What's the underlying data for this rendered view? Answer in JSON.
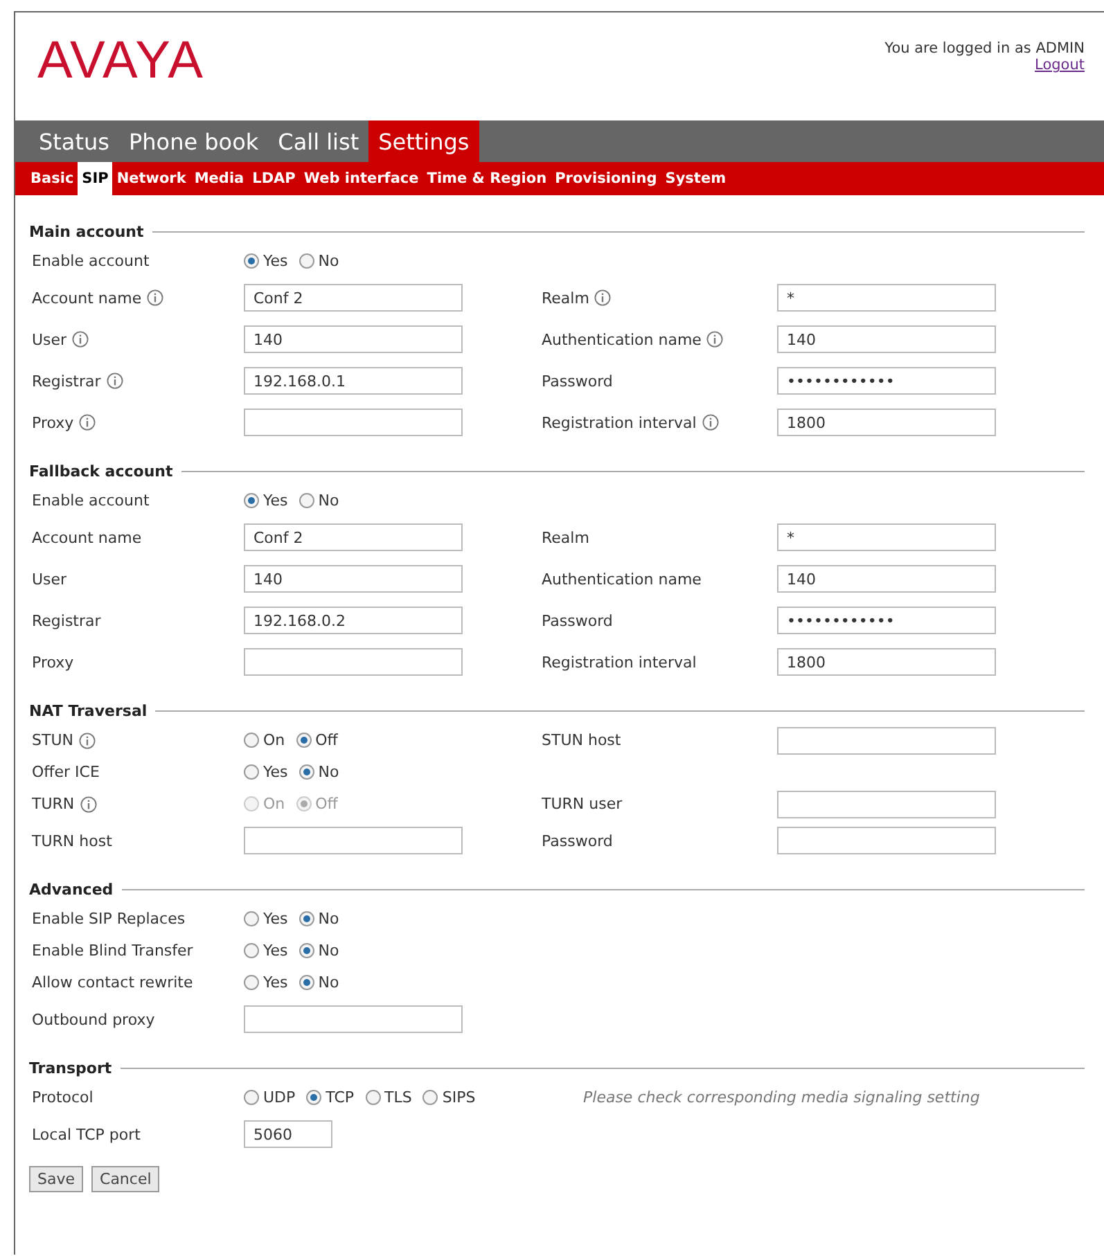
{
  "header": {
    "logo": "AVAYA",
    "login_text": "You are logged in as ADMIN",
    "logout_link": "Logout"
  },
  "main_tabs": [
    {
      "label": "Status",
      "selected": false
    },
    {
      "label": "Phone book",
      "selected": false
    },
    {
      "label": "Call list",
      "selected": false
    },
    {
      "label": "Settings",
      "selected": true
    }
  ],
  "sub_tabs": [
    {
      "label": "Basic",
      "selected": false
    },
    {
      "label": "SIP",
      "selected": true
    },
    {
      "label": "Network",
      "selected": false
    },
    {
      "label": "Media",
      "selected": false
    },
    {
      "label": "LDAP",
      "selected": false
    },
    {
      "label": "Web interface",
      "selected": false
    },
    {
      "label": "Time & Region",
      "selected": false
    },
    {
      "label": "Provisioning",
      "selected": false
    },
    {
      "label": "System",
      "selected": false
    }
  ],
  "sections": [
    {
      "title": "Main account",
      "rows": [
        {
          "left": {
            "label": "Enable account",
            "info": false,
            "kind": "radio",
            "options": [
              {
                "label": "Yes",
                "selected": true,
                "disabled": false
              },
              {
                "label": "No",
                "selected": false,
                "disabled": false
              }
            ]
          }
        },
        {
          "left": {
            "label": "Account name",
            "info": true,
            "kind": "text",
            "value": "Conf 2"
          },
          "right": {
            "label": "Realm",
            "info": true,
            "kind": "text",
            "value": "*"
          }
        },
        {
          "left": {
            "label": "User",
            "info": true,
            "kind": "text",
            "value": "140"
          },
          "right": {
            "label": "Authentication name",
            "info": true,
            "kind": "text",
            "value": "140"
          }
        },
        {
          "left": {
            "label": "Registrar",
            "info": true,
            "kind": "text",
            "value": "192.168.0.1"
          },
          "right": {
            "label": "Password",
            "info": false,
            "kind": "text",
            "value": "••••••••••••"
          }
        },
        {
          "left": {
            "label": "Proxy",
            "info": true,
            "kind": "text"
          },
          "right": {
            "label": "Registration interval",
            "info": true,
            "kind": "text",
            "value": "1800"
          }
        }
      ]
    },
    {
      "title": "Fallback account",
      "rows": [
        {
          "left": {
            "label": "Enable account",
            "info": false,
            "kind": "radio",
            "options": [
              {
                "label": "Yes",
                "selected": true,
                "disabled": false
              },
              {
                "label": "No",
                "selected": false,
                "disabled": false
              }
            ]
          }
        },
        {
          "left": {
            "label": "Account name",
            "info": false,
            "kind": "text",
            "value": "Conf 2"
          },
          "right": {
            "label": "Realm",
            "info": false,
            "kind": "text",
            "value": "*"
          }
        },
        {
          "left": {
            "label": "User",
            "info": false,
            "kind": "text",
            "value": "140"
          },
          "right": {
            "label": "Authentication name",
            "info": false,
            "kind": "text",
            "value": "140"
          }
        },
        {
          "left": {
            "label": "Registrar",
            "info": false,
            "kind": "text",
            "value": "192.168.0.2"
          },
          "right": {
            "label": "Password",
            "info": false,
            "kind": "text",
            "value": "••••••••••••"
          }
        },
        {
          "left": {
            "label": "Proxy",
            "info": false,
            "kind": "text"
          },
          "right": {
            "label": "Registration interval",
            "info": false,
            "kind": "text",
            "value": "1800"
          }
        }
      ]
    },
    {
      "title": "NAT Traversal",
      "rows": [
        {
          "left": {
            "label": "STUN",
            "info": true,
            "kind": "radio",
            "options": [
              {
                "label": "On",
                "selected": false,
                "disabled": false
              },
              {
                "label": "Off",
                "selected": true,
                "disabled": false
              }
            ]
          },
          "right": {
            "label": "STUN host",
            "info": false,
            "kind": "text"
          }
        },
        {
          "left": {
            "label": "Offer ICE",
            "info": false,
            "kind": "radio",
            "options": [
              {
                "label": "Yes",
                "selected": false,
                "disabled": false
              },
              {
                "label": "No",
                "selected": true,
                "disabled": false
              }
            ]
          }
        },
        {
          "left": {
            "label": "TURN",
            "info": true,
            "kind": "radio",
            "options": [
              {
                "label": "On",
                "selected": false,
                "disabled": true
              },
              {
                "label": "Off",
                "selected": true,
                "disabled": true
              }
            ]
          },
          "right": {
            "label": "TURN user",
            "info": false,
            "kind": "text"
          }
        },
        {
          "left": {
            "label": "TURN host",
            "info": false,
            "kind": "text"
          },
          "right": {
            "label": "Password",
            "info": false,
            "kind": "text"
          }
        }
      ]
    },
    {
      "title": "Advanced",
      "rows": [
        {
          "left": {
            "label": "Enable SIP Replaces",
            "info": false,
            "kind": "radio",
            "options": [
              {
                "label": "Yes",
                "selected": false,
                "disabled": false
              },
              {
                "label": "No",
                "selected": true,
                "disabled": false
              }
            ]
          }
        },
        {
          "left": {
            "label": "Enable Blind Transfer",
            "info": false,
            "kind": "radio",
            "options": [
              {
                "label": "Yes",
                "selected": false,
                "disabled": false
              },
              {
                "label": "No",
                "selected": true,
                "disabled": false
              }
            ]
          }
        },
        {
          "left": {
            "label": "Allow contact rewrite",
            "info": false,
            "kind": "radio",
            "options": [
              {
                "label": "Yes",
                "selected": false,
                "disabled": false
              },
              {
                "label": "No",
                "selected": true,
                "disabled": false
              }
            ]
          }
        },
        {
          "left": {
            "label": "Outbound proxy",
            "info": false,
            "kind": "text"
          }
        }
      ]
    },
    {
      "title": "Transport",
      "rows": [
        {
          "left": {
            "label": "Protocol",
            "info": false,
            "kind": "radio",
            "options": [
              {
                "label": "UDP",
                "selected": false,
                "disabled": false
              },
              {
                "label": "TCP",
                "selected": true,
                "disabled": false
              },
              {
                "label": "TLS",
                "selected": false,
                "disabled": false
              },
              {
                "label": "SIPS",
                "selected": false,
                "disabled": false
              }
            ]
          },
          "note": "Please check corresponding media signaling setting"
        },
        {
          "left": {
            "label": "Local TCP port",
            "info": false,
            "kind": "short",
            "value": "5060"
          }
        }
      ]
    }
  ],
  "buttons": [
    "Save",
    "Cancel"
  ]
}
